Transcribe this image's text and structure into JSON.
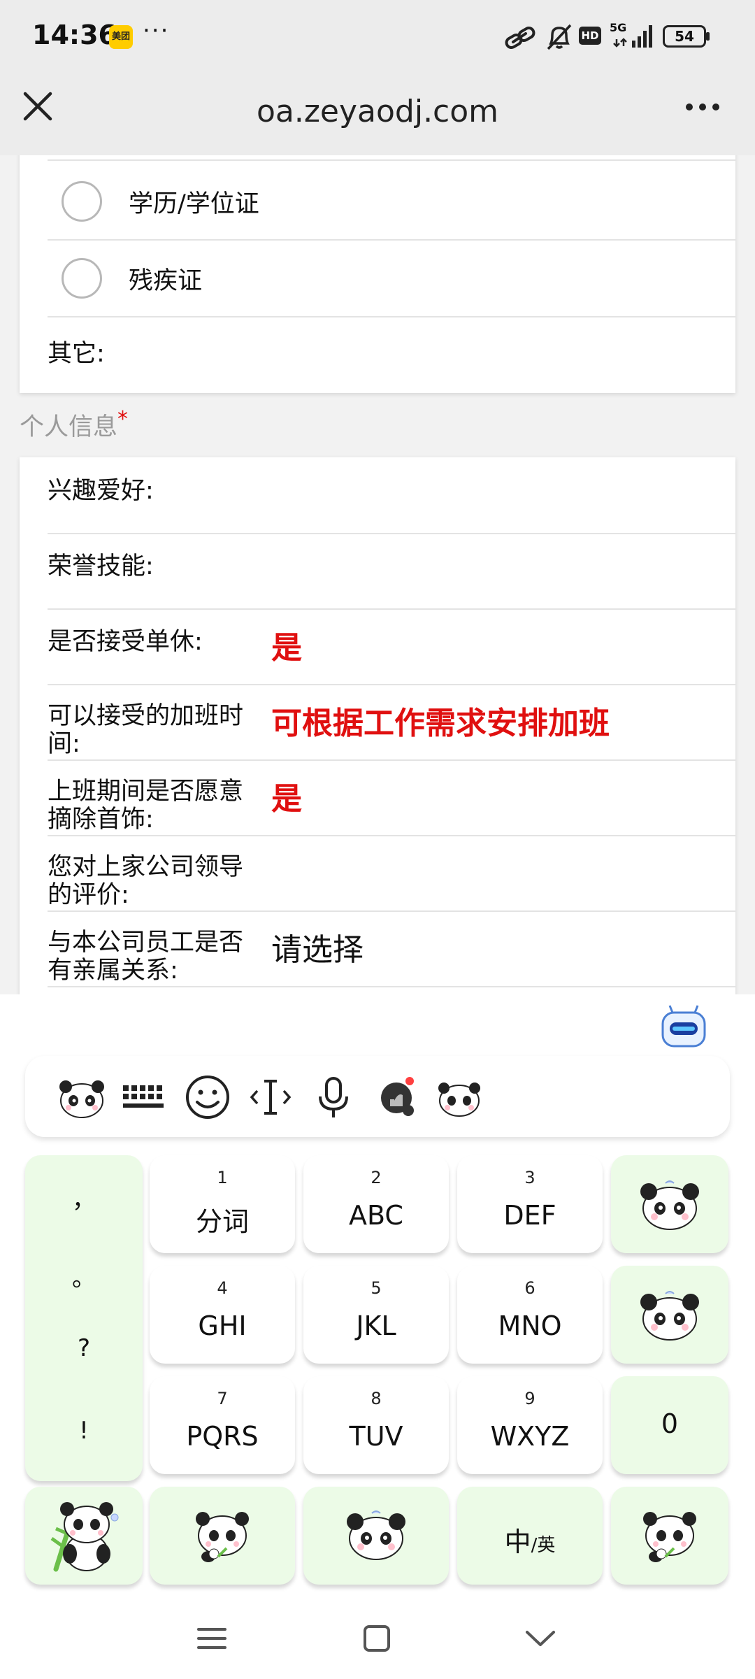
{
  "status_bar": {
    "time": "14:36",
    "app_badge": "美团",
    "dots": "···",
    "battery": "54",
    "network": "5G"
  },
  "browser": {
    "url": "oa.zeyaodj.com"
  },
  "form": {
    "card1": {
      "options": [
        "学历/学位证",
        "残疾证"
      ],
      "other_label": "其它:"
    },
    "section_title": "个人信息",
    "required_mark": "*",
    "fields": [
      {
        "label": "兴趣爱好:",
        "value": ""
      },
      {
        "label": "荣誉技能:",
        "value": ""
      },
      {
        "label": "是否接受单休:",
        "value": "是"
      },
      {
        "label": "可以接受的加班时间:",
        "value": "可根据工作需求安排加班"
      },
      {
        "label": "上班期间是否愿意摘除首饰:",
        "value": "是"
      },
      {
        "label": "您对上家公司领导的评价:",
        "value": ""
      },
      {
        "label": "与本公司员工是否有亲属关系:",
        "value": "请选择"
      }
    ]
  },
  "keyboard": {
    "punctuation": [
      "，",
      "。",
      "?",
      "!"
    ],
    "keys": [
      {
        "num": "1",
        "letters": "分词"
      },
      {
        "num": "2",
        "letters": "ABC"
      },
      {
        "num": "3",
        "letters": "DEF"
      },
      {
        "num": "4",
        "letters": "GHI"
      },
      {
        "num": "5",
        "letters": "JKL"
      },
      {
        "num": "6",
        "letters": "MNO"
      },
      {
        "num": "7",
        "letters": "PQRS"
      },
      {
        "num": "8",
        "letters": "TUV"
      },
      {
        "num": "9",
        "letters": "WXYZ"
      }
    ],
    "zero": "0",
    "lang_switch": "中/英",
    "lang_main": "中",
    "lang_sub": "/英"
  },
  "colors": {
    "accent_red": "#e01010",
    "key_green": "#ecfbe7"
  }
}
